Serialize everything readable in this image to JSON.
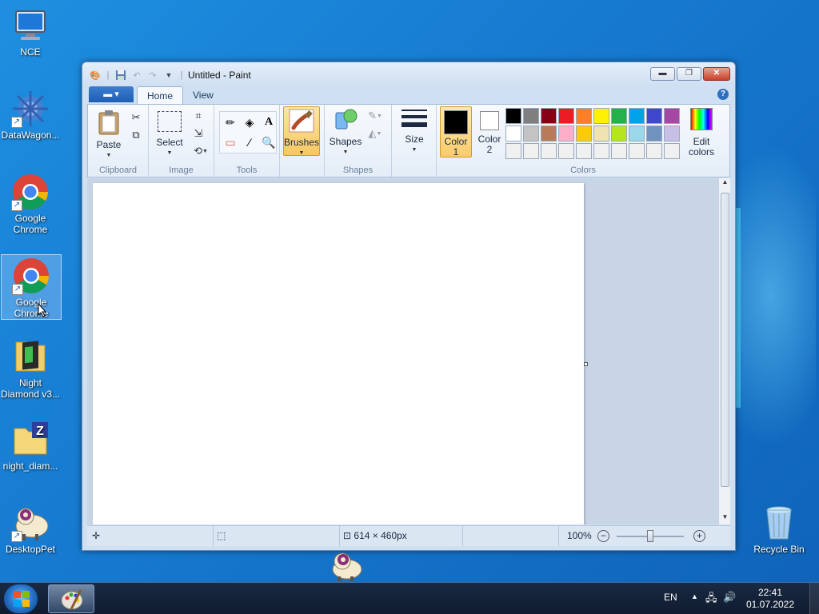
{
  "desktop": {
    "icons": [
      {
        "label": "NCE"
      },
      {
        "label": "DataWagon..."
      },
      {
        "label": "Google Chrome"
      },
      {
        "label": "Google Chrome"
      },
      {
        "label": "Night Diamond v3..."
      },
      {
        "label": "night_diam..."
      },
      {
        "label": "DesktopPet"
      },
      {
        "label": "Recycle Bin"
      }
    ]
  },
  "paint": {
    "title": "Untitled - Paint",
    "tabs": {
      "home": "Home",
      "view": "View"
    },
    "groups": {
      "clipboard": "Clipboard",
      "image": "Image",
      "tools": "Tools",
      "shapes": "Shapes",
      "colors": "Colors"
    },
    "buttons": {
      "paste": "Paste",
      "select": "Select",
      "brushes": "Brushes",
      "shapes": "Shapes",
      "size": "Size",
      "color1": "Color\n1",
      "color1_a": "Color",
      "color1_b": "1",
      "color2_a": "Color",
      "color2_b": "2",
      "edit_colors_a": "Edit",
      "edit_colors_b": "colors"
    },
    "color1": "#000000",
    "color2": "#ffffff",
    "palette": [
      "#000000",
      "#7f7f7f",
      "#880015",
      "#ed1c24",
      "#ff7f27",
      "#fff200",
      "#22b14c",
      "#00a2e8",
      "#3f48cc",
      "#a349a4",
      "#ffffff",
      "#c3c3c3",
      "#b97a57",
      "#ffaec9",
      "#ffc90e",
      "#efe4b0",
      "#b5e61d",
      "#99d9ea",
      "#7092be",
      "#c8bfe7",
      "#f0f0f0",
      "#f0f0f0",
      "#f0f0f0",
      "#f0f0f0",
      "#f0f0f0",
      "#f0f0f0",
      "#f0f0f0",
      "#f0f0f0",
      "#f0f0f0",
      "#f0f0f0"
    ],
    "status": {
      "image_size": "614 × 460px",
      "zoom": "100%"
    }
  },
  "taskbar": {
    "language": "EN",
    "time": "22:41",
    "date": "01.07.2022"
  }
}
